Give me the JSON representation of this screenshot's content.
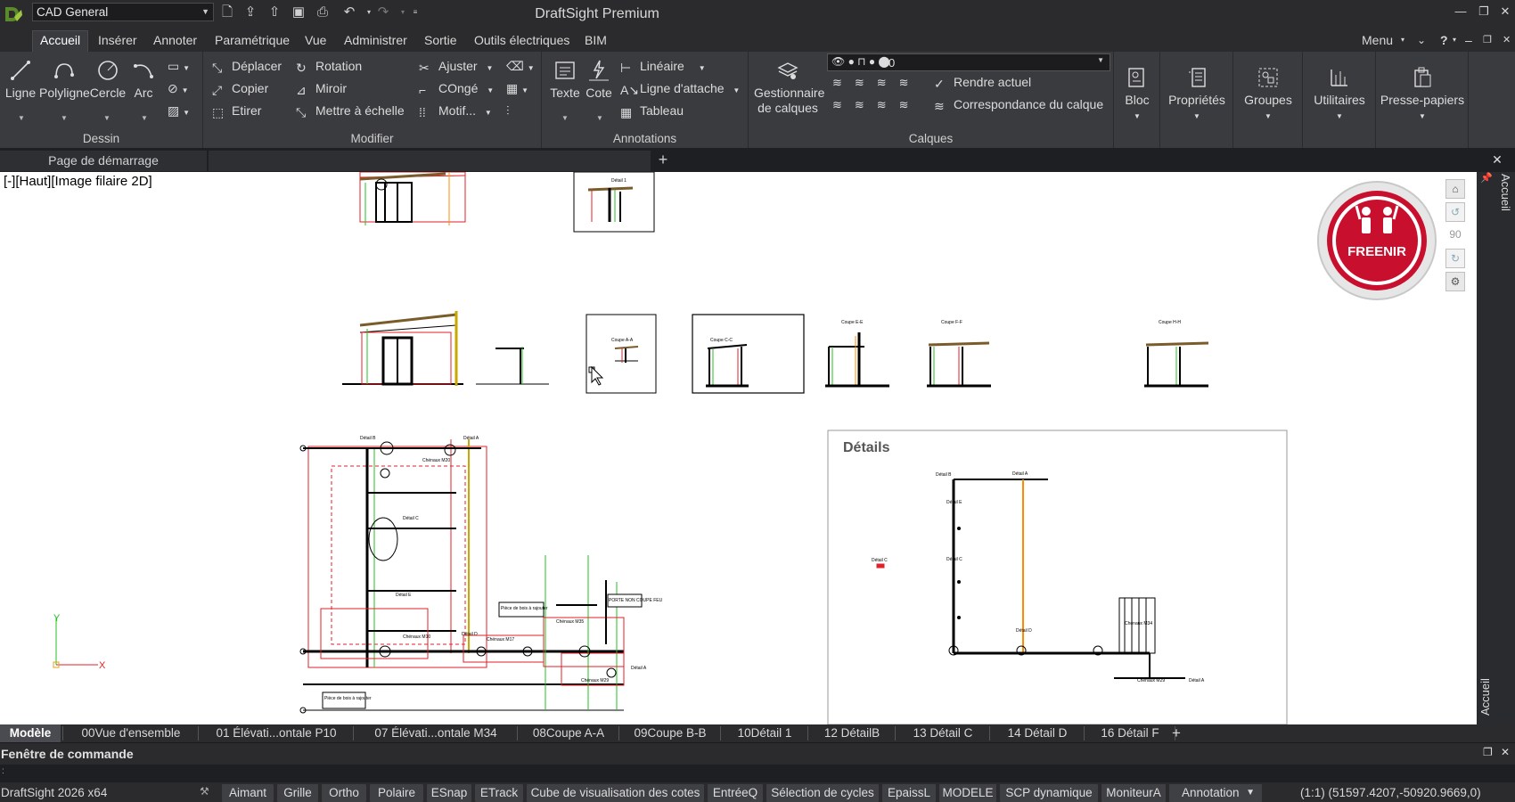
{
  "titlebar": {
    "workspace": "CAD General",
    "app_title": "DraftSight Premium",
    "menu_label": "Menu"
  },
  "menus": [
    "Accueil",
    "Insérer",
    "Annoter",
    "Paramétrique",
    "Vue",
    "Administrer",
    "Sortie",
    "Outils électriques",
    "BIM"
  ],
  "ribbon": {
    "dessin": {
      "label": "Dessin",
      "ligne": "Ligne",
      "polyligne": "Polyligne",
      "cercle": "Cercle",
      "arc": "Arc"
    },
    "modifier": {
      "label": "Modifier",
      "deplacer": "Déplacer",
      "copier": "Copier",
      "etirer": "Etirer",
      "rotation": "Rotation",
      "miroir": "Miroir",
      "mettre_echelle": "Mettre à échelle",
      "ajuster": "Ajuster",
      "conge": "COngé",
      "motif": "Motif..."
    },
    "annotations": {
      "label": "Annotations",
      "texte": "Texte",
      "cote": "Cote",
      "lineaire": "Linéaire",
      "ligne_attache": "Ligne d'attache",
      "tableau": "Tableau"
    },
    "calques": {
      "label": "Calques",
      "gestionnaire_1": "Gestionnaire",
      "gestionnaire_2": "de calques",
      "layer_value": "0",
      "rendre_actuel": "Rendre actuel",
      "correspondance": "Correspondance du calque"
    },
    "bloc": "Bloc",
    "proprietes": "Propriétés",
    "groupes": "Groupes",
    "utilitaires": "Utilitaires",
    "presse_papiers": "Presse-papiers"
  },
  "doc_tabs": {
    "start_page": "Page de démarrage"
  },
  "viewport": {
    "label": "[-][Haut][Image filaire 2D]",
    "details_title": "Détails",
    "freenir": "FREENIR",
    "nav_angle": "90",
    "side_label": "Accueil"
  },
  "drawing_labels": {
    "detail1": "Détail 1",
    "coupe_aa": "Coupe A-A",
    "coupe_cc": "Coupe C-C",
    "coupe_ee": "Coupe E-E",
    "coupe_ff": "Coupe F-F",
    "coupe_hh": "Coupe H-H",
    "detail_a": "Détail A",
    "detail_b": "Détail B",
    "detail_c": "Détail C",
    "detail_d": "Détail D",
    "detail_e": "Détail E",
    "chenaux_m20": "Chénaux M20",
    "chenaux_m34": "Chénaux M34",
    "chenaux_m35": "Chénaux M35",
    "chenaux_m17": "Chénaux M17",
    "chenaux_m29": "Chénaux M29",
    "chenaux_m10": "Chénaux M10",
    "piece_bois": "Pièce de bois à rajouter",
    "porte_non": "PORTE NON COUPE FEU"
  },
  "axis": {
    "x": "X",
    "y": "Y"
  },
  "layout_tabs": [
    "Modèle",
    "00Vue d'ensemble",
    "01 Élévati...ontale P10",
    "07 Élévati...ontale M34",
    "08Coupe A-A",
    "09Coupe B-B",
    "10Détail 1",
    "12 DétailB",
    "13 Détail C",
    "14 Détail D",
    "16 Détail F"
  ],
  "command_window": "Fenêtre de commande",
  "status": {
    "product": "DraftSight 2026 x64",
    "buttons": [
      "Aimant",
      "Grille",
      "Ortho",
      "Polaire",
      "ESnap",
      "ETrack",
      "Cube de visualisation des cotes",
      "EntréeQ",
      "Sélection de cycles",
      "EpaissL",
      "MODELE",
      "SCP dynamique",
      "MoniteurA",
      "Annotation"
    ],
    "scale": "(1:1)",
    "coords": "(51597.4207,-50920.9669,0)"
  },
  "colors": {
    "accent": "#c8102e",
    "drawing_red": "#e3202a",
    "drawing_green": "#22c022",
    "drawing_orange": "#ff8c00"
  }
}
